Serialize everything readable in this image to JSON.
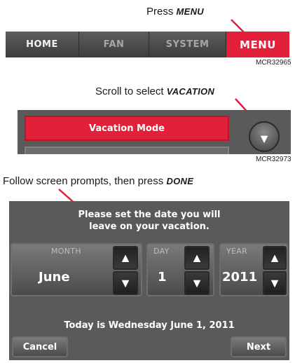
{
  "step1": {
    "caption_text": "Press ",
    "caption_emphasis": "MENU",
    "tabs": [
      {
        "label": "HOME",
        "state": "normal"
      },
      {
        "label": "FAN",
        "state": "dimmed"
      },
      {
        "label": "SYSTEM",
        "state": "dimmed"
      },
      {
        "label": "MENU",
        "state": "selected"
      }
    ],
    "ref_code": "MCR32965"
  },
  "step2": {
    "caption_text": "Scroll to select ",
    "caption_emphasis": "VACATION",
    "selected_item": "Vacation Mode",
    "ref_code": "MCR32973"
  },
  "step3": {
    "caption_text": "Follow screen prompts, then press ",
    "caption_emphasis": "DONE",
    "prompt_line1": "Please set the date you will",
    "prompt_line2": "leave on your vacation.",
    "month": {
      "label": "MONTH",
      "value": "June"
    },
    "day": {
      "label": "DAY",
      "value": "1"
    },
    "year": {
      "label": "YEAR",
      "value": "2011"
    },
    "today": "Today is Wednesday June 1, 2011",
    "cancel_label": "Cancel",
    "next_label": "Next"
  },
  "icons": {
    "up": "up-arrow-icon",
    "down": "down-arrow-icon"
  },
  "colors": {
    "accent_red": "#e3203a",
    "panel_gray": "#5a5a5a",
    "callout_line": "#e3203a"
  }
}
